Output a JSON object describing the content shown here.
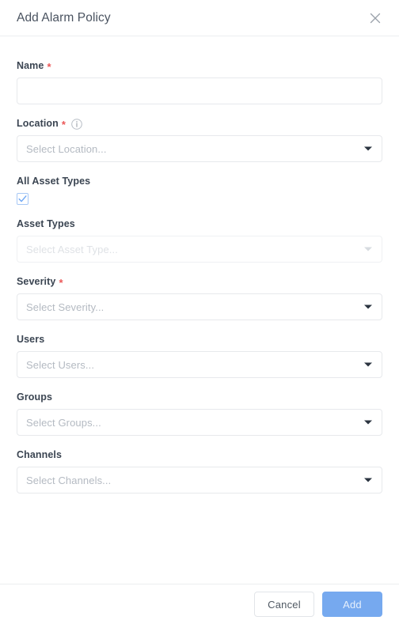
{
  "dialog": {
    "title": "Add Alarm Policy",
    "close_icon": "close-icon"
  },
  "form": {
    "fields": [
      {
        "label": "Name",
        "required": true,
        "type": "text",
        "value": "",
        "placeholder": "",
        "disabled": false
      },
      {
        "label": "Location",
        "required": true,
        "has_info": true,
        "type": "select",
        "value": "",
        "placeholder": "Select Location...",
        "disabled": false
      },
      {
        "label": "All Asset Types",
        "required": false,
        "type": "checkbox",
        "checked": true
      },
      {
        "label": "Asset Types",
        "required": false,
        "type": "select",
        "value": "",
        "placeholder": "Select Asset Type...",
        "disabled": true
      },
      {
        "label": "Severity",
        "required": true,
        "type": "select",
        "value": "",
        "placeholder": "Select Severity...",
        "disabled": false
      },
      {
        "label": "Users",
        "required": false,
        "type": "select",
        "value": "",
        "placeholder": "Select Users...",
        "disabled": false
      },
      {
        "label": "Groups",
        "required": false,
        "type": "select",
        "value": "",
        "placeholder": "Select Groups...",
        "disabled": false
      },
      {
        "label": "Channels",
        "required": false,
        "type": "select",
        "value": "",
        "placeholder": "Select Channels...",
        "disabled": false
      }
    ],
    "required_marker": "*"
  },
  "footer": {
    "cancel_label": "Cancel",
    "add_label": "Add"
  },
  "colors": {
    "accent": "#76a9ef",
    "required": "#eb5757",
    "label": "#3b4552",
    "placeholder": "#b4bac2",
    "border": "#e7e9ec"
  }
}
